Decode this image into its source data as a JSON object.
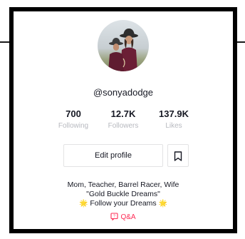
{
  "profile": {
    "username": "@sonyadodge",
    "avatar_icon": "profile-photo"
  },
  "stats": [
    {
      "value": "700",
      "label": "Following"
    },
    {
      "value": "12.7K",
      "label": "Followers"
    },
    {
      "value": "137.9K",
      "label": "Likes"
    }
  ],
  "actions": {
    "edit_profile_label": "Edit profile",
    "bookmark_icon": "bookmark-icon"
  },
  "bio": {
    "line1": "Mom, Teacher, Barrel Racer, Wife",
    "line2": "\"Gold Buckle Dreams\"",
    "line3": "Follow your Dreams",
    "line3_emoji": "🌟"
  },
  "qa": {
    "label": "Q&A",
    "color": "#fe2c55"
  },
  "colors": {
    "text": "#161823",
    "muted": "#b7b9bf",
    "accent": "#fe2c55",
    "border": "#000000"
  }
}
